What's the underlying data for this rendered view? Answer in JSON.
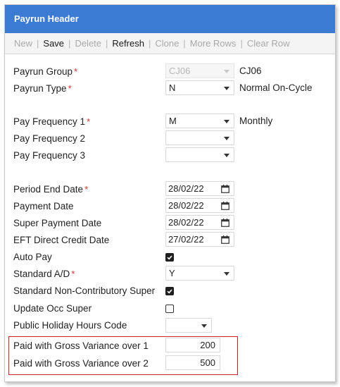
{
  "header": {
    "title": "Payrun Header"
  },
  "toolbar": {
    "new": "New",
    "save": "Save",
    "delete": "Delete",
    "refresh": "Refresh",
    "clone": "Clone",
    "more_rows": "More Rows",
    "clear_row": "Clear Row",
    "separator": "|"
  },
  "fields": {
    "payrun_group": {
      "label": "Payrun Group",
      "required": "*",
      "value": "CJ06",
      "description": "CJ06"
    },
    "payrun_type": {
      "label": "Payrun Type",
      "required": "*",
      "value": "N",
      "description": "Normal On-Cycle"
    },
    "pay_frequency_1": {
      "label": "Pay Frequency 1",
      "required": "*",
      "value": "M",
      "description": "Monthly"
    },
    "pay_frequency_2": {
      "label": "Pay Frequency 2",
      "value": ""
    },
    "pay_frequency_3": {
      "label": "Pay Frequency 3",
      "value": ""
    },
    "period_end_date": {
      "label": "Period End Date",
      "required": "*",
      "value": "28/02/22"
    },
    "payment_date": {
      "label": "Payment Date",
      "value": "28/02/22"
    },
    "super_payment_date": {
      "label": "Super Payment Date",
      "value": "28/02/22"
    },
    "eft_direct_credit_date": {
      "label": "EFT Direct Credit Date",
      "value": "27/02/22"
    },
    "auto_pay": {
      "label": "Auto Pay",
      "checked": true
    },
    "standard_ad": {
      "label": "Standard A/D",
      "required": "*",
      "value": "Y"
    },
    "standard_non_contributory_super": {
      "label": "Standard Non-Contributory Super",
      "checked": true
    },
    "update_occ_super": {
      "label": "Update Occ Super",
      "checked": false
    },
    "public_holiday_hours_code": {
      "label": "Public Holiday Hours Code",
      "value": ""
    },
    "paid_gross_variance_1": {
      "label": "Paid with Gross Variance over 1",
      "value": "200"
    },
    "paid_gross_variance_2": {
      "label": "Paid with Gross Variance over 2",
      "value": "500"
    }
  },
  "colors": {
    "header_bg": "#3c7bd4",
    "required": "#d9302c",
    "highlight_border": "#c9242b"
  },
  "icons": {
    "calendar": "calendar-icon",
    "dropdown": "chevron-down-icon",
    "check": "check-icon"
  }
}
